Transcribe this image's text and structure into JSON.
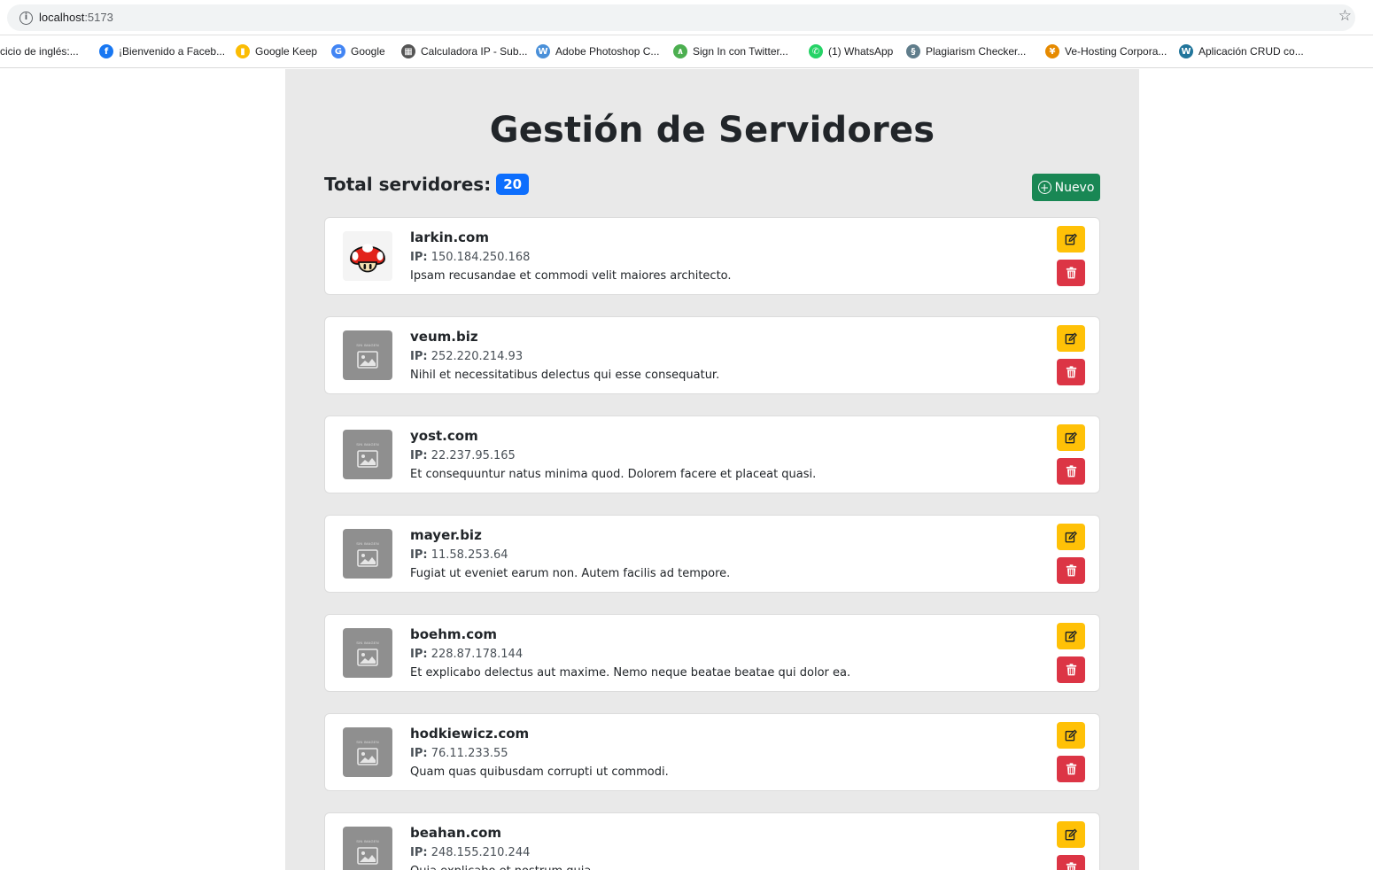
{
  "browser": {
    "url_host": "localhost",
    "url_port": ":5173",
    "bookmarks": [
      {
        "label": "cicio de inglés:...",
        "icon": "none"
      },
      {
        "label": "¡Bienvenido a Faceb...",
        "icon": "facebook-icon",
        "color": "#1877f2"
      },
      {
        "label": "Google Keep",
        "icon": "keep-icon",
        "color": "#fbbc04"
      },
      {
        "label": "Google",
        "icon": "google-icon",
        "color": "#4285f4"
      },
      {
        "label": "Calculadora IP - Sub...",
        "icon": "calculator-icon",
        "color": "#555555"
      },
      {
        "label": "Adobe Photoshop C...",
        "icon": "w-icon",
        "color": "#4a90d9"
      },
      {
        "label": "Sign In con Twitter...",
        "icon": "chart-icon",
        "color": "#4caf50"
      },
      {
        "label": "(1) WhatsApp",
        "icon": "whatsapp-icon",
        "color": "#25d366"
      },
      {
        "label": "Plagiarism Checker...",
        "icon": "swirl-icon",
        "color": "#607d8b"
      },
      {
        "label": "Ve-Hosting Corpora...",
        "icon": "figure-icon",
        "color": "#e68a00"
      },
      {
        "label": "Aplicación CRUD co...",
        "icon": "wordpress-icon",
        "color": "#21759b"
      }
    ]
  },
  "page": {
    "title": "Gestión de Servidores",
    "total_label": "Total servidores:",
    "total_count": "20",
    "new_button": "Nuevo"
  },
  "colors": {
    "badge": "#0d6efd",
    "new_button": "#198754",
    "edit_button": "#ffc107",
    "delete_button": "#dc3545",
    "container_bg": "#e9e9e9"
  },
  "ip_label": "IP:",
  "placeholder_text": "SIN IMAGEN",
  "servers": [
    {
      "name": "larkin.com",
      "ip": "150.184.250.168",
      "description": "Ipsam recusandae et commodi velit maiores architecto.",
      "image": "mushroom"
    },
    {
      "name": "veum.biz",
      "ip": "252.220.214.93",
      "description": "Nihil et necessitatibus delectus qui esse consequatur.",
      "image": "placeholder"
    },
    {
      "name": "yost.com",
      "ip": "22.237.95.165",
      "description": "Et consequuntur natus minima quod. Dolorem facere et placeat quasi.",
      "image": "placeholder"
    },
    {
      "name": "mayer.biz",
      "ip": "11.58.253.64",
      "description": "Fugiat ut eveniet earum non. Autem facilis ad tempore.",
      "image": "placeholder"
    },
    {
      "name": "boehm.com",
      "ip": "228.87.178.144",
      "description": "Et explicabo delectus aut maxime. Nemo neque beatae beatae qui dolor ea.",
      "image": "placeholder"
    },
    {
      "name": "hodkiewicz.com",
      "ip": "76.11.233.55",
      "description": "Quam quas quibusdam corrupti ut commodi.",
      "image": "placeholder"
    },
    {
      "name": "beahan.com",
      "ip": "248.155.210.244",
      "description": "Quia explicabo et nostrum quia.",
      "image": "placeholder"
    }
  ]
}
